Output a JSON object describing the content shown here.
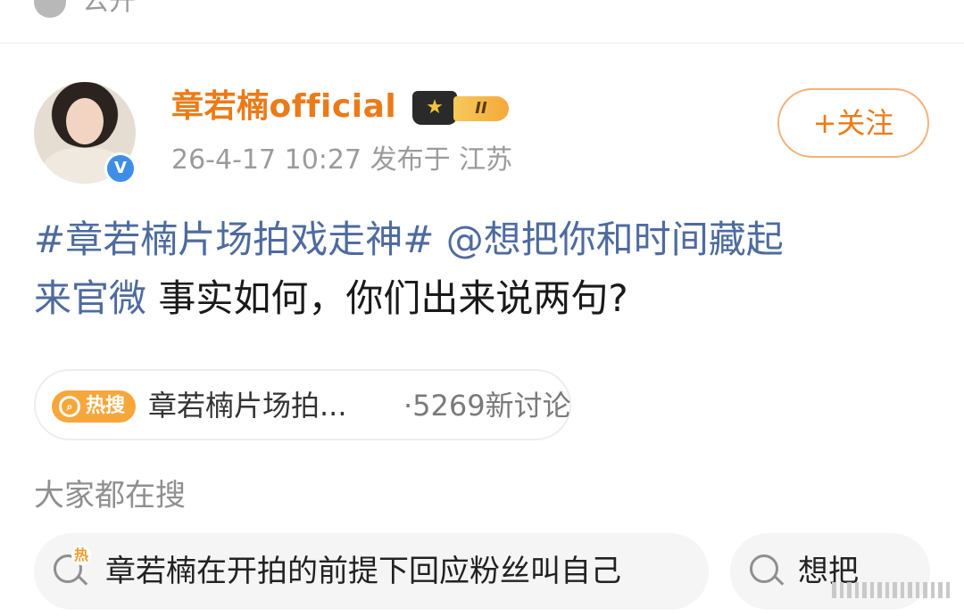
{
  "top": {
    "visibility_label": "公开"
  },
  "author": {
    "name": "章若楠official",
    "verified_mark": "V",
    "member_level": "II",
    "crown_icon": "crown-icon",
    "timestamp": "26-4-17 10:27",
    "location_text": "发布于 江苏",
    "follow_label": "+关注"
  },
  "post": {
    "hashtag": "#章若楠片场拍戏走神#",
    "mention_line1": "@想把你和时间藏起",
    "mention_line2": "来官微",
    "body": "事实如何，你们出来说两句?"
  },
  "hot_search": {
    "badge": "热搜",
    "title": "章若楠片场拍...",
    "count": "·5269新讨论"
  },
  "related": {
    "title": "大家都在搜",
    "items": [
      {
        "label": "章若楠在开拍的前提下回应粉丝叫自己",
        "hot": "热"
      },
      {
        "label": "想把"
      }
    ]
  },
  "colors": {
    "author_orange": "#eb7b18",
    "link_blue": "#4e6b9e",
    "hot_orange": "#f7a73a",
    "verified_blue": "#3e8ee8"
  }
}
